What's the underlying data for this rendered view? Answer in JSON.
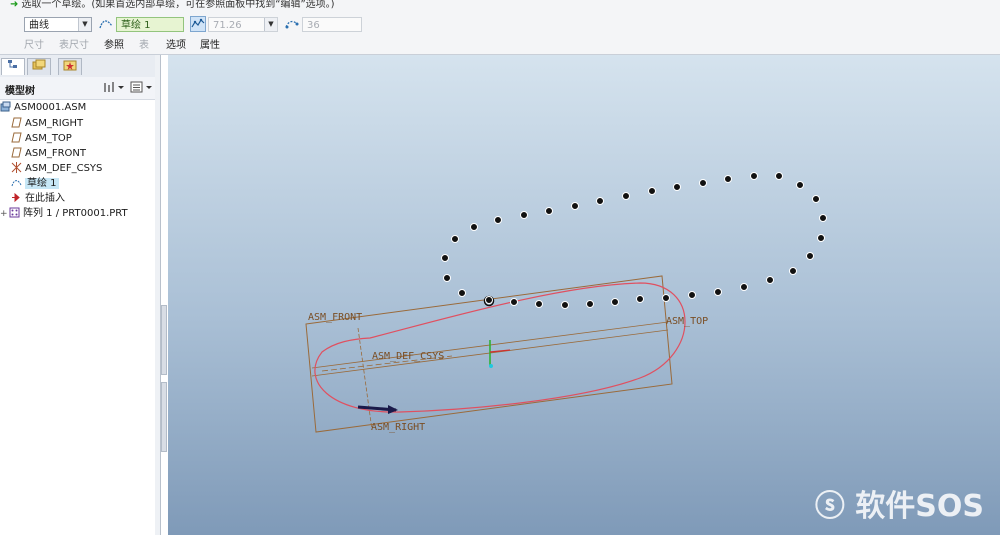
{
  "dashboard": {
    "message": "选取一个草绘。(如果首选内部草绘，可在参照面板中找到“编辑”选项。)",
    "type_value": "曲线",
    "sketch_value": "草绘 1",
    "pitch_value": "71.26",
    "count_value": "36",
    "tabs": [
      "尺寸",
      "表尺寸",
      "参照",
      "表",
      "选项",
      "属性"
    ]
  },
  "panel": {
    "title": "模型树",
    "items": [
      "ASM0001.ASM",
      "ASM_RIGHT",
      "ASM_TOP",
      "ASM_FRONT",
      "ASM_DEF_CSYS",
      "草绘 1",
      "在此插入",
      "阵列 1 / PRT0001.PRT"
    ]
  },
  "canvas": {
    "labels": {
      "front": "ASM_FRONT",
      "top": "ASM_TOP",
      "right": "ASM_RIGHT",
      "csys": "ASM_DEF_CSYS"
    },
    "watermark": "软件SOS"
  },
  "colors": {
    "accent": "#cfe3f7",
    "sketch": "#e05060",
    "datum": "#9a6a3a",
    "bg_top": "#d5e3ee",
    "bg_bottom": "#7f9ab8"
  }
}
